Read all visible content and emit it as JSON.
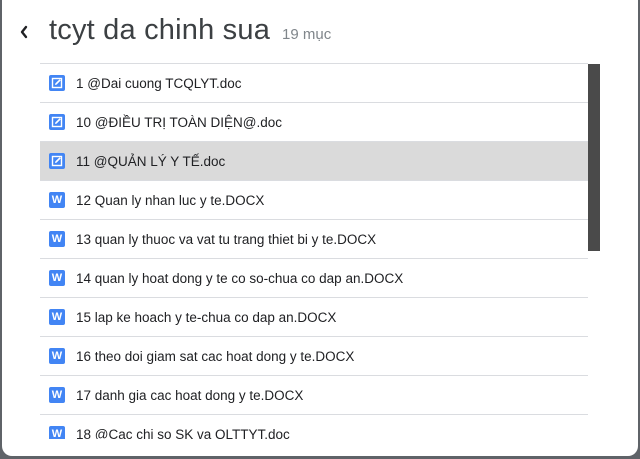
{
  "header": {
    "title": "tcyt da chinh sua",
    "count": "19 mục",
    "back_icon": "chevron-left-icon"
  },
  "files": [
    {
      "name": "1 @Dai cuong TCQLYT.doc",
      "icon": "edit-doc-icon",
      "icon_glyph": "",
      "selected": false
    },
    {
      "name": "10 @ĐIỀU TRỊ TOÀN DIỆN@.doc",
      "icon": "edit-doc-icon",
      "icon_glyph": "",
      "selected": false
    },
    {
      "name": "11 @QUẢN LÝ Y TẾ.doc",
      "icon": "edit-doc-icon",
      "icon_glyph": "",
      "selected": true
    },
    {
      "name": "12 Quan ly nhan luc y te.DOCX",
      "icon": "word-icon",
      "icon_glyph": "W",
      "selected": false
    },
    {
      "name": "13 quan ly thuoc va vat tu trang thiet bi y te.DOCX",
      "icon": "word-icon",
      "icon_glyph": "W",
      "selected": false
    },
    {
      "name": "14 quan ly hoat dong y te co so-chua co dap an.DOCX",
      "icon": "word-icon",
      "icon_glyph": "W",
      "selected": false
    },
    {
      "name": "15 lap ke hoach y te-chua co dap an.DOCX",
      "icon": "word-icon",
      "icon_glyph": "W",
      "selected": false
    },
    {
      "name": "16 theo doi giam sat cac hoat dong y te.DOCX",
      "icon": "word-icon",
      "icon_glyph": "W",
      "selected": false
    },
    {
      "name": "17 danh gia cac hoat dong y te.DOCX",
      "icon": "word-icon",
      "icon_glyph": "W",
      "selected": false
    },
    {
      "name": "18 @Cac chi so SK va QLTTYT.doc",
      "icon": "word-icon",
      "icon_glyph": "W",
      "selected": false
    }
  ],
  "colors": {
    "icon_blue": "#4285f4",
    "selected_row": "#dadada",
    "scrollbar": "#4a4a4a"
  }
}
